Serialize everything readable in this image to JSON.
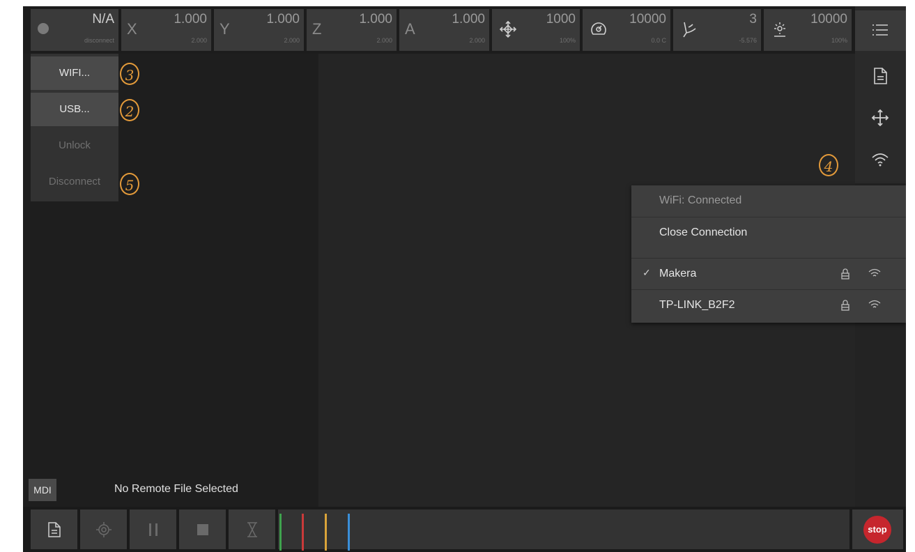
{
  "status": {
    "connection": {
      "value": "N/A",
      "state": "disconnect"
    },
    "axes": [
      {
        "label": "X",
        "value": "1.000",
        "sub": "2.000"
      },
      {
        "label": "Y",
        "value": "1.000",
        "sub": "2.000"
      },
      {
        "label": "Z",
        "value": "1.000",
        "sub": "2.000"
      },
      {
        "label": "A",
        "value": "1.000",
        "sub": "2.000"
      }
    ],
    "feed": {
      "icon": "move-arrows-icon",
      "value": "1000",
      "sub": "100%"
    },
    "spindle": {
      "icon": "spindle-gauge-icon",
      "value": "10000",
      "sub": "0.0 C"
    },
    "tool": {
      "icon": "tool-icon",
      "value": "3",
      "sub": "-5.576"
    },
    "laser": {
      "icon": "laser-icon",
      "value": "10000",
      "sub": "100%"
    }
  },
  "left_panel": {
    "wifi_label": "WIFI...",
    "usb_label": "USB...",
    "unlock_label": "Unlock",
    "disconnect_label": "Disconnect"
  },
  "annotations": {
    "wifi": "3",
    "usb": "2",
    "disconnect": "5",
    "wifi_icon": "4"
  },
  "wifi_menu": {
    "status": "WiFi: Connected",
    "close_label": "Close Connection",
    "networks": [
      {
        "name": "Makera",
        "selected": true,
        "locked": true
      },
      {
        "name": "TP-LINK_B2F2",
        "selected": false,
        "locked": true
      }
    ]
  },
  "bottom": {
    "mdi_label": "MDI",
    "file_status": "No Remote File Selected",
    "stop_label": "stop",
    "color_lines": [
      "#3fa34d",
      "#c93a3a",
      "#d9a43a",
      "#3a8fd9"
    ]
  }
}
